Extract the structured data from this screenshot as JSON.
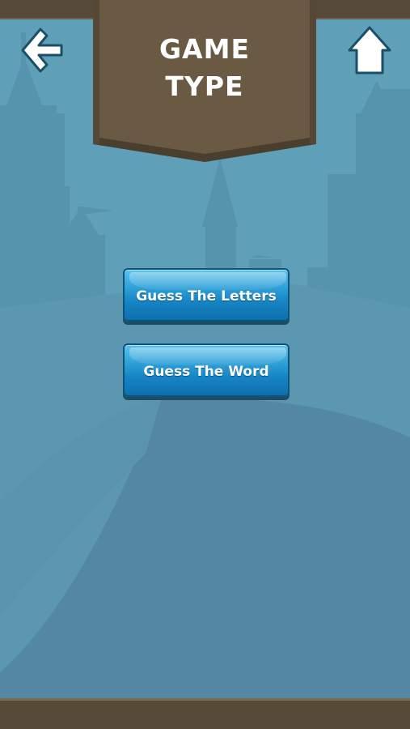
{
  "screen": {
    "title_lines": [
      "GAME",
      "TYPE"
    ],
    "background_color": "#5f9fb8",
    "bar_color": "#574a38",
    "banner_color": "#6a5a44"
  },
  "navigation": {
    "back_icon": "back-arrow-icon",
    "home_icon": "home-icon"
  },
  "menu": {
    "options": [
      {
        "label": "Guess The Letters"
      },
      {
        "label": "Guess The Word"
      }
    ],
    "button_color": "#1786c6"
  }
}
